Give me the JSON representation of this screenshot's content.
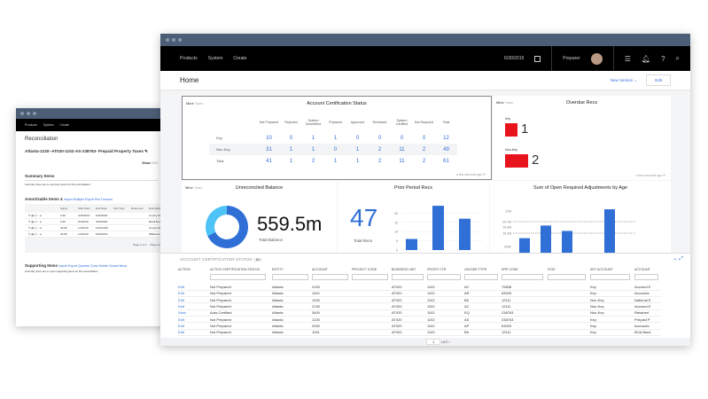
{
  "left_window": {
    "nav": [
      "Products",
      "System",
      "Create"
    ],
    "page_title": "Reconciliation",
    "rec_title": "Atlanta-1220--AT020-1102-AS-238763- Prepaid Property Taxes",
    "show_label": "Show",
    "show_options": "USD · ...",
    "summary_title": "Summary Items",
    "summary_empty": "Currently, there are no summary items for this reconciliation.",
    "amortizable_title": "Amortizable Items",
    "amortizable_count": "4",
    "amortizable_actions": [
      "Import",
      "Multiple",
      "Export",
      "Roll Forward"
    ],
    "amortizable_headers": [
      "Aging",
      "Start Date",
      "End Date",
      "Sub Type",
      "Reference",
      "Description"
    ],
    "amortizable_rows": [
      [
        "0-30",
        "4/15/2019",
        "6/15/2020",
        "",
        "",
        "County Re..."
      ],
      [
        "0-30",
        "5/1/2019",
        "4/30/2020",
        "",
        "",
        "Bevill Rea..."
      ],
      [
        "30-60",
        "1/1/2019",
        "12/31/2019",
        "",
        "",
        "County Re..."
      ],
      [
        "30-60",
        "1/1/2019",
        "6/30/2019",
        "",
        "",
        "Millamore..."
      ]
    ],
    "pager": "Page 1 of 1",
    "page_size": "Page size: 5",
    "supporting_title": "Supporting Items",
    "supporting_actions": [
      "Import",
      "Export",
      "Queries",
      "Clone",
      "Delete",
      "Closed Items"
    ],
    "supporting_empty": "Currently, there are no open supporting items for this reconciliation."
  },
  "main_window": {
    "nav": [
      "Products",
      "System",
      "Create"
    ],
    "date": "6/30/2019",
    "role": "Preparer",
    "icons": [
      "calendar-icon",
      "avatar",
      "list-icon",
      "bell-icon",
      "help-icon",
      "search-icon"
    ],
    "page_title": "Home",
    "new_version": "New Version",
    "edit": "Edit",
    "mine": "Mine",
    "team": "Team",
    "updated": "a few seconds ago",
    "acs": {
      "title": "Account Certification Status",
      "headers": [
        "Not Prepared",
        "Rejected",
        "System Decertified",
        "Prepared",
        "Approved",
        "Reviewed",
        "System Certified",
        "Not Required",
        "Total"
      ],
      "rows": [
        {
          "label": "Key",
          "values": [
            "10",
            "0",
            "1",
            "1",
            "0",
            "0",
            "0",
            "0",
            "12"
          ]
        },
        {
          "label": "Non-Key",
          "values": [
            "31",
            "1",
            "1",
            "0",
            "1",
            "2",
            "11",
            "2",
            "49"
          ]
        },
        {
          "label": "Total",
          "values": [
            "41",
            "1",
            "2",
            "1",
            "1",
            "2",
            "11",
            "2",
            "61"
          ]
        }
      ]
    },
    "overdue": {
      "title": "Overdue Recs",
      "items": [
        {
          "label": "Key",
          "value": "1"
        },
        {
          "label": "Non-Key",
          "value": "2"
        }
      ],
      "color": "#e8141c"
    },
    "unreconciled": {
      "title": "Unreconciled Balance",
      "value": "559.5m",
      "caption": "Total Balance",
      "donut_fraction": 0.68,
      "colors": [
        "#2f6fd6",
        "#4dc3f7"
      ]
    },
    "chart_data": [
      {
        "type": "bar",
        "title": "Prior Period Recs",
        "kpi": "47",
        "kpi_label": "Total Recs",
        "yticks": [
          "0",
          "5",
          "10",
          "15",
          "20"
        ],
        "ylim": [
          0,
          25
        ],
        "values": [
          6,
          24,
          17
        ],
        "color": "#2f6fd6"
      },
      {
        "type": "bar",
        "title": "Sum of Open Required Adjustments by Age",
        "yticks": [
          "200K",
          "15.1M",
          "14.3M",
          "20.7M",
          "21M"
        ],
        "values": [
          2,
          3.4,
          2.8,
          0,
          5.2
        ],
        "color": "#2f6fd6"
      }
    ],
    "table": {
      "title": "ACCOUNT CERTIFICATION STATUS",
      "count": "61",
      "headers": [
        "ACTION",
        "ACTIVE CERTIFICATION STATUS",
        "ENTITY",
        "ACCOUNT",
        "PROJECT CODE",
        "BUSINESS UNIT",
        "PROFIT CTR",
        "LEDGER TYPE",
        "ERP CODE",
        "STAT",
        "KEY ACCOUNT",
        "ACCOUNT"
      ],
      "rows": [
        [
          "Edit",
          "Not Prepared",
          "Atlanta",
          "2100",
          "",
          "AT020",
          "1102",
          "AC",
          "79838",
          "",
          "Key",
          "Accrued E"
        ],
        [
          "Edit",
          "Not Prepared",
          "Atlanta",
          "1100",
          "",
          "AT020",
          "1102",
          "AR",
          "63003",
          "",
          "Key",
          "Accounts"
        ],
        [
          "Edit",
          "Not Prepared",
          "Atlanta",
          "1000",
          "",
          "AT020",
          "1102",
          "BK",
          "12111",
          "",
          "Non-Key",
          "National E"
        ],
        [
          "Edit",
          "Not Prepared",
          "Atlanta",
          "2130",
          "",
          "AT020",
          "1102",
          "AC",
          "12111",
          "",
          "Non-Key",
          "Accrued E"
        ],
        [
          "View",
          "Auto-Certified",
          "Atlanta",
          "3400",
          "",
          "AT020",
          "1102",
          "EQ",
          "238763",
          "",
          "Non-Key",
          "Retained"
        ],
        [
          "Edit",
          "Not Prepared",
          "Atlanta",
          "1220",
          "",
          "AT020",
          "1102",
          "AS",
          "238763",
          "",
          "Key",
          "Prepaid P"
        ],
        [
          "Edit",
          "Not Prepared",
          "Atlanta",
          "2000",
          "",
          "AT020",
          "1102",
          "AP",
          "63003",
          "",
          "Key",
          "Accounts"
        ],
        [
          "Edit",
          "Not Prepared",
          "Atlanta",
          "1001",
          "",
          "AT020",
          "1102",
          "BK",
          "12111",
          "",
          "Key",
          "BOA Bank"
        ]
      ],
      "page": "1",
      "of_pages": "of 2"
    }
  }
}
